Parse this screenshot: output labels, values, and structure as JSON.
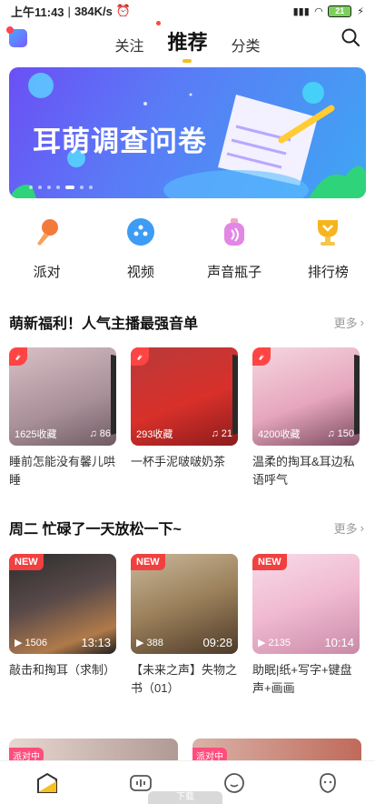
{
  "status_bar": {
    "time": "上午11:43",
    "speed": "384K/s",
    "battery": "21"
  },
  "top_nav": {
    "tabs": [
      {
        "label": "关注"
      },
      {
        "label": "推荐"
      },
      {
        "label": "分类"
      }
    ],
    "active_tab": "推荐"
  },
  "banner": {
    "title": "耳萌调查问卷",
    "slides": 7,
    "active_slide": 5
  },
  "quick_links": [
    {
      "label": "派对",
      "icon": "microphone-icon",
      "color": "#f47a3b"
    },
    {
      "label": "视频",
      "icon": "video-icon",
      "color": "#3d9cf5"
    },
    {
      "label": "声音瓶子",
      "icon": "sound-bottle-icon",
      "color": "#c56bf0"
    },
    {
      "label": "排行榜",
      "icon": "trophy-icon",
      "color": "#f6b51f"
    }
  ],
  "section1": {
    "title": "萌新福利！人气主播最强音单",
    "more": "更多",
    "cards": [
      {
        "collect": "1625收藏",
        "count": "86",
        "title": "睡前怎能没有馨儿哄睡"
      },
      {
        "collect": "293收藏",
        "count": "21",
        "title": "一杯手泥啵啵奶茶"
      },
      {
        "collect": "4200收藏",
        "count": "150",
        "title": "温柔的掏耳&耳边私语呼气"
      }
    ]
  },
  "section2": {
    "title": "周二 忙碌了一天放松一下~",
    "more": "更多",
    "cards": [
      {
        "badge": "NEW",
        "plays": "1506",
        "duration": "13:13",
        "title": "敲击和掏耳（求制）"
      },
      {
        "badge": "NEW",
        "plays": "388",
        "duration": "09:28",
        "title": "【未来之声】失物之书（01）"
      },
      {
        "badge": "NEW",
        "plays": "2135",
        "duration": "10:14",
        "title": "助眠|纸+写字+键盘声+画画"
      }
    ]
  },
  "party": {
    "badge": "派对中"
  },
  "bottom_nav": {
    "items": [
      {
        "icon": "home-icon"
      },
      {
        "icon": "live-icon"
      },
      {
        "icon": "message-icon"
      },
      {
        "icon": "profile-icon"
      }
    ],
    "toast": "下载"
  },
  "colors": {
    "accent": "#f6c022",
    "new_badge": "#f04040",
    "banner_start": "#6b4ff5",
    "banner_end": "#3fa6f3"
  }
}
